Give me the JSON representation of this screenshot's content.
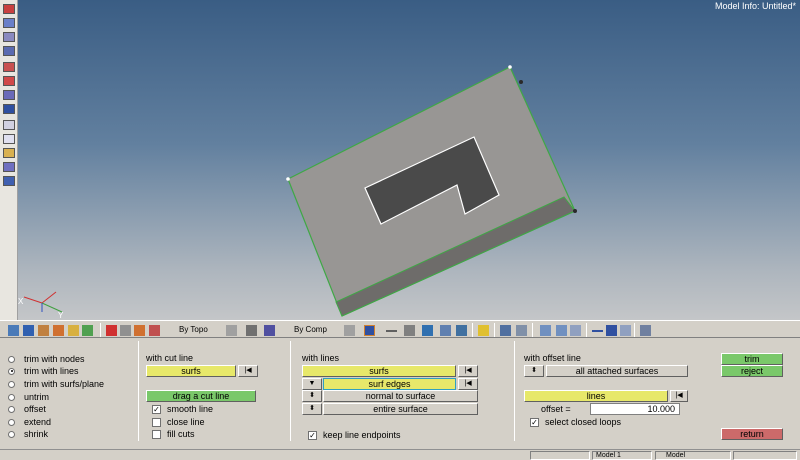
{
  "viewport": {
    "model_info": "Model Info: Untitled*",
    "axis_x": "X",
    "axis_y": "Y"
  },
  "toolbar": {
    "by_topo": "By Topo",
    "by_comp": "By Comp"
  },
  "panel": {
    "radios": [
      {
        "label": "trim with nodes",
        "selected": false
      },
      {
        "label": "trim with lines",
        "selected": true
      },
      {
        "label": "trim with surfs/plane",
        "selected": false
      },
      {
        "label": "untrim",
        "selected": false
      },
      {
        "label": "offset",
        "selected": false
      },
      {
        "label": "extend",
        "selected": false
      },
      {
        "label": "shrink",
        "selected": false
      }
    ],
    "cut_line": {
      "title": "with cut line",
      "surfs": "surfs",
      "drag": "drag a cut line",
      "smooth_line": "smooth line",
      "close_line": "close line",
      "fill_cuts": "fill cuts"
    },
    "lines": {
      "title": "with lines",
      "surfs": "surfs",
      "surf_edges": "surf edges",
      "normal": "normal to surface",
      "entire": "entire surface",
      "keep_endpoints": "keep line endpoints"
    },
    "offset_line": {
      "title": "with offset line",
      "attached": "all attached surfaces",
      "lines": "lines",
      "offset_label": "offset =",
      "offset_value": "10.000",
      "closed_loops": "select closed loops"
    },
    "actions": {
      "trim": "trim",
      "reject": "reject",
      "return": "return"
    }
  },
  "statusbar": {
    "model_slot": "Model 1",
    "model_tab": "Model"
  },
  "colors": {
    "yellow": "#e7e86a",
    "green": "#7ac86a",
    "red": "#cc6a6a",
    "surface": "#9a9896",
    "edge": "#3fa845"
  }
}
